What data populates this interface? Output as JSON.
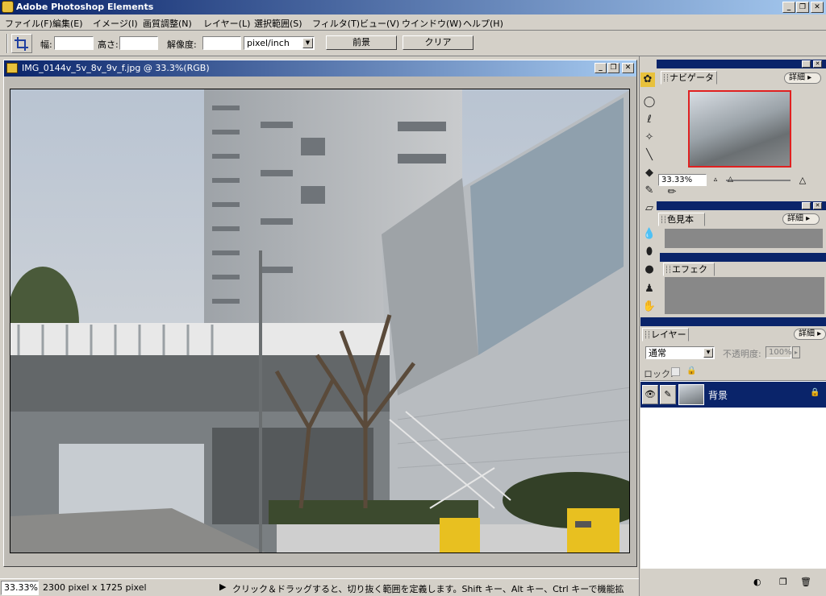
{
  "app": {
    "title": "Adobe Photoshop Elements"
  },
  "window_controls": {
    "minimize": "_",
    "restore": "❐",
    "close": "✕"
  },
  "menu": [
    "ファイル(F)",
    "編集(E)",
    "イメージ(I)",
    "画質調整(N)",
    "レイヤー(L)",
    "選択範囲(S)",
    "フィルタ(T)",
    "ビュー(V)",
    "ウインドウ(W)",
    "ヘルプ(H)"
  ],
  "options": {
    "width_label": "幅:",
    "height_label": "高さ:",
    "resolution_label": "解像度:",
    "unit_value": "pixel/inch",
    "front_image_button": "前景",
    "clear_button": "クリア"
  },
  "document": {
    "title": "IMG_0144v_5v_8v_9v_f.jpg @ 33.3%(RGB)"
  },
  "status": {
    "zoom": "33.33%",
    "size": "2300 pixel x 1725 pixel",
    "hint": "クリック＆ドラッグすると、切り抜く範囲を定義します。Shift キー、Alt キー、Ctrl キーで機能拡張。"
  },
  "navigator": {
    "tab": "ナビゲータ",
    "details": "詳細",
    "zoom": "33.33%"
  },
  "swatches": {
    "tab": "色見本",
    "details": "詳細"
  },
  "effects": {
    "tab": "エフェクト"
  },
  "layers": {
    "tab": "レイヤー",
    "details": "詳細",
    "blend_mode": "通常",
    "opacity_label": "不透明度:",
    "opacity_value": "100%",
    "lock_label": "ロック:",
    "layer_name": "背景"
  },
  "colors": {
    "titlebar": "#0a246a",
    "face": "#d4d0c8",
    "selection": "#0a246a",
    "nav_frame": "#e02020"
  }
}
